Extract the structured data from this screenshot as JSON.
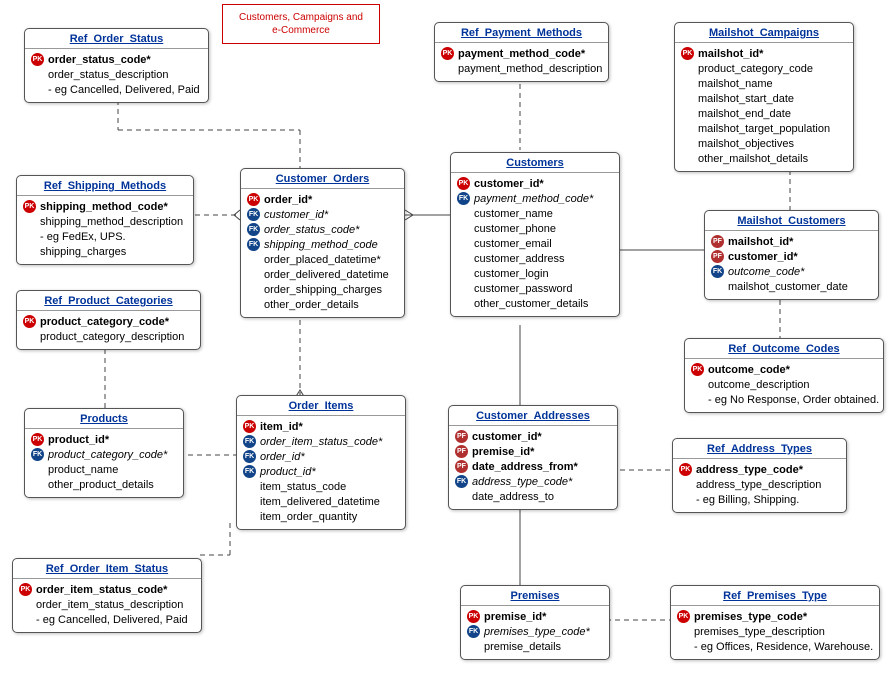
{
  "legend": {
    "line1": "Customers, Campaigns and",
    "line2": "e-Commerce"
  },
  "entities": {
    "ref_order_status": {
      "title": "Ref_Order_Status",
      "attrs": [
        {
          "key": "pk",
          "label": "order_status_code*",
          "bold": true
        },
        {
          "key": "",
          "label": "order_status_description"
        },
        {
          "key": "",
          "label": "- eg Cancelled, Delivered, Paid"
        }
      ]
    },
    "ref_payment_methods": {
      "title": "Ref_Payment_Methods",
      "attrs": [
        {
          "key": "pk",
          "label": "payment_method_code*",
          "bold": true
        },
        {
          "key": "",
          "label": "payment_method_description"
        }
      ]
    },
    "mailshot_campaigns": {
      "title": "Mailshot_Campaigns",
      "attrs": [
        {
          "key": "pk",
          "label": "mailshot_id*",
          "bold": true
        },
        {
          "key": "",
          "label": "product_category_code"
        },
        {
          "key": "",
          "label": "mailshot_name"
        },
        {
          "key": "",
          "label": "mailshot_start_date"
        },
        {
          "key": "",
          "label": "mailshot_end_date"
        },
        {
          "key": "",
          "label": "mailshot_target_population"
        },
        {
          "key": "",
          "label": "mailshot_objectives"
        },
        {
          "key": "",
          "label": "other_mailshot_details"
        }
      ]
    },
    "ref_shipping_methods": {
      "title": "Ref_Shipping_Methods",
      "attrs": [
        {
          "key": "pk",
          "label": "shipping_method_code*",
          "bold": true
        },
        {
          "key": "",
          "label": "shipping_method_description"
        },
        {
          "key": "",
          "label": "- eg FedEx, UPS."
        },
        {
          "key": "",
          "label": "shipping_charges"
        }
      ]
    },
    "customer_orders": {
      "title": "Customer_Orders",
      "attrs": [
        {
          "key": "pk",
          "label": "order_id*",
          "bold": true
        },
        {
          "key": "fk",
          "label": "customer_id*",
          "em": true
        },
        {
          "key": "fk",
          "label": "order_status_code*",
          "em": true
        },
        {
          "key": "fk",
          "label": "shipping_method_code",
          "em": true
        },
        {
          "key": "",
          "label": "order_placed_datetime*"
        },
        {
          "key": "",
          "label": "order_delivered_datetime"
        },
        {
          "key": "",
          "label": "order_shipping_charges"
        },
        {
          "key": "",
          "label": "other_order_details"
        }
      ]
    },
    "customers": {
      "title": "Customers",
      "attrs": [
        {
          "key": "pk",
          "label": "customer_id*",
          "bold": true
        },
        {
          "key": "fk",
          "label": "payment_method_code*",
          "em": true
        },
        {
          "key": "",
          "label": "customer_name"
        },
        {
          "key": "",
          "label": "customer_phone"
        },
        {
          "key": "",
          "label": "customer_email"
        },
        {
          "key": "",
          "label": "customer_address"
        },
        {
          "key": "",
          "label": "customer_login"
        },
        {
          "key": "",
          "label": "customer_password"
        },
        {
          "key": "",
          "label": "other_customer_details"
        }
      ]
    },
    "mailshot_customers": {
      "title": "Mailshot_Customers",
      "attrs": [
        {
          "key": "pf",
          "label": "mailshot_id*",
          "bold": true
        },
        {
          "key": "pf",
          "label": "customer_id*",
          "bold": true
        },
        {
          "key": "fk",
          "label": "outcome_code*",
          "em": true
        },
        {
          "key": "",
          "label": "mailshot_customer_date"
        }
      ]
    },
    "ref_product_categories": {
      "title": "Ref_Product_Categories",
      "attrs": [
        {
          "key": "pk",
          "label": "product_category_code*",
          "bold": true
        },
        {
          "key": "",
          "label": "product_category_description"
        }
      ]
    },
    "ref_outcome_codes": {
      "title": "Ref_Outcome_Codes",
      "attrs": [
        {
          "key": "pk",
          "label": "outcome_code*",
          "bold": true
        },
        {
          "key": "",
          "label": "outcome_description"
        },
        {
          "key": "",
          "label": "- eg No Response, Order obtained."
        }
      ]
    },
    "products": {
      "title": "Products",
      "attrs": [
        {
          "key": "pk",
          "label": "product_id*",
          "bold": true
        },
        {
          "key": "fk",
          "label": "product_category_code*",
          "em": true
        },
        {
          "key": "",
          "label": "product_name"
        },
        {
          "key": "",
          "label": "other_product_details"
        }
      ]
    },
    "order_items": {
      "title": "Order_Items",
      "attrs": [
        {
          "key": "pk",
          "label": "item_id*",
          "bold": true
        },
        {
          "key": "fk",
          "label": "order_item_status_code*",
          "em": true
        },
        {
          "key": "fk",
          "label": "order_id*",
          "em": true
        },
        {
          "key": "fk",
          "label": "product_id*",
          "em": true
        },
        {
          "key": "",
          "label": "item_status_code"
        },
        {
          "key": "",
          "label": "item_delivered_datetime"
        },
        {
          "key": "",
          "label": "item_order_quantity"
        }
      ]
    },
    "customer_addresses": {
      "title": "Customer_Addresses",
      "attrs": [
        {
          "key": "pf",
          "label": "customer_id*",
          "bold": true
        },
        {
          "key": "pf",
          "label": "premise_id*",
          "bold": true
        },
        {
          "key": "pf",
          "label": "date_address_from*",
          "bold": true
        },
        {
          "key": "fk",
          "label": "address_type_code*",
          "em": true
        },
        {
          "key": "",
          "label": "date_address_to"
        }
      ]
    },
    "ref_address_types": {
      "title": "Ref_Address_Types",
      "attrs": [
        {
          "key": "pk",
          "label": "address_type_code*",
          "bold": true
        },
        {
          "key": "",
          "label": "address_type_description"
        },
        {
          "key": "",
          "label": "- eg Billing, Shipping."
        }
      ]
    },
    "ref_order_item_status": {
      "title": "Ref_Order_Item_Status",
      "attrs": [
        {
          "key": "pk",
          "label": "order_item_status_code*",
          "bold": true
        },
        {
          "key": "",
          "label": "order_item_status_description"
        },
        {
          "key": "",
          "label": "- eg Cancelled, Delivered, Paid"
        }
      ]
    },
    "premises": {
      "title": "Premises",
      "attrs": [
        {
          "key": "pk",
          "label": "premise_id*",
          "bold": true
        },
        {
          "key": "fk",
          "label": "premises_type_code*",
          "em": true
        },
        {
          "key": "",
          "label": "premise_details"
        }
      ]
    },
    "ref_premises_type": {
      "title": "Ref_Premises_Type",
      "attrs": [
        {
          "key": "pk",
          "label": "premises_type_code*",
          "bold": true
        },
        {
          "key": "",
          "label": "premises_type_description"
        },
        {
          "key": "",
          "label": "- eg Offices, Residence, Warehouse."
        }
      ]
    }
  }
}
